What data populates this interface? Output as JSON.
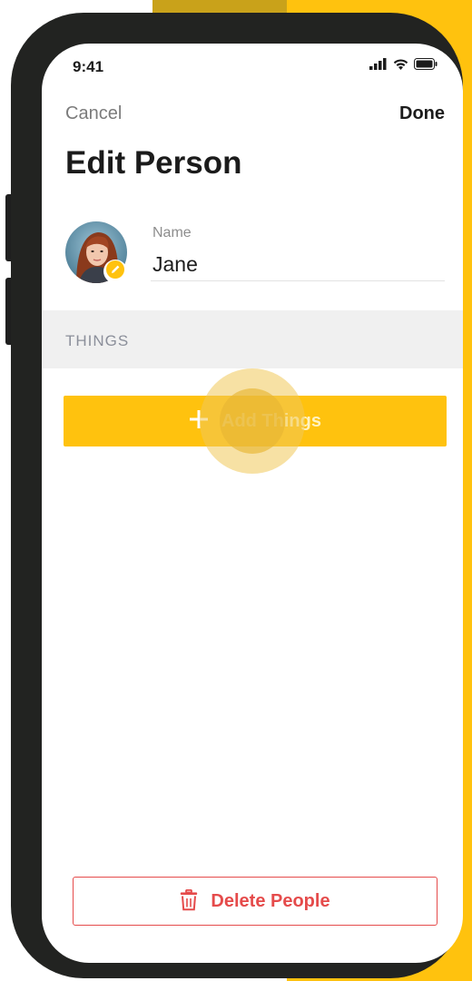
{
  "status_bar": {
    "time": "9:41"
  },
  "nav": {
    "cancel_label": "Cancel",
    "done_label": "Done"
  },
  "page": {
    "title": "Edit Person"
  },
  "person": {
    "name_label": "Name",
    "name_value": "Jane"
  },
  "things": {
    "section_label": "THINGS",
    "add_button_label": "Add Things"
  },
  "actions": {
    "delete_label": "Delete People"
  },
  "icons": {
    "avatar_edit": "pencil-icon",
    "add": "plus-icon",
    "delete": "trash-icon",
    "signal": "signal-bars-icon",
    "wifi": "wifi-icon",
    "battery": "battery-icon"
  },
  "colors": {
    "accent": "#FFC20E",
    "danger": "#E54B4B",
    "section_bg": "#F0F0F0"
  }
}
